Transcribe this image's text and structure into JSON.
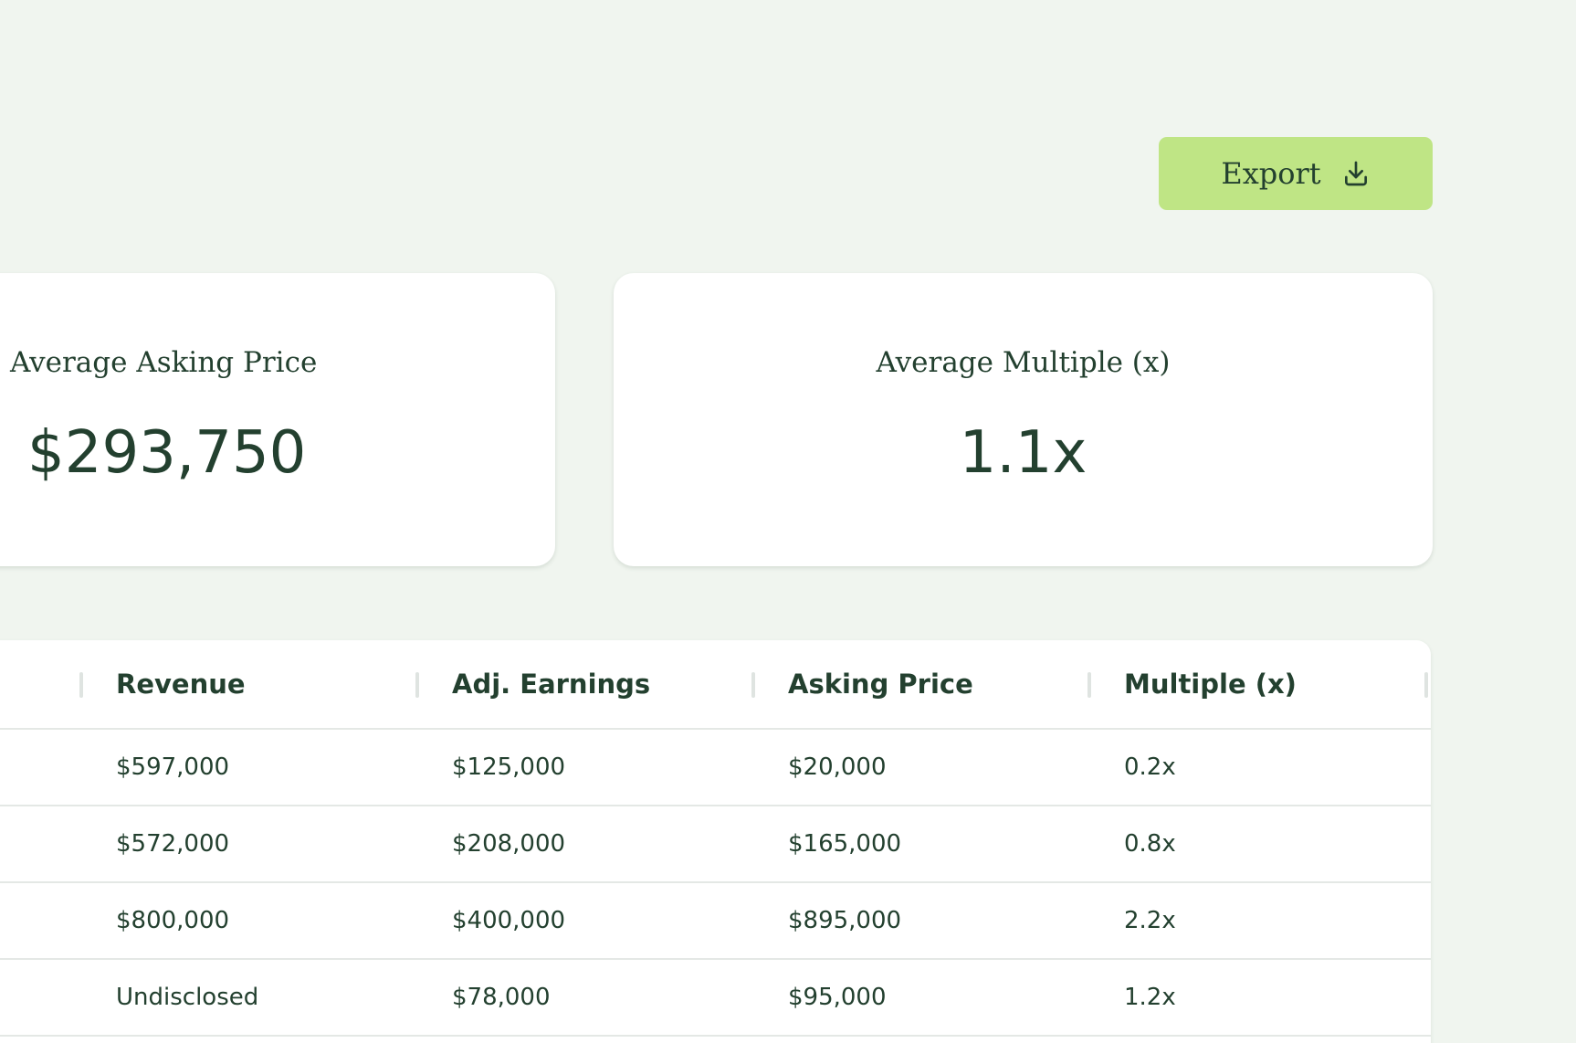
{
  "toolbar": {
    "export_label": "Export",
    "export_icon": "download-icon"
  },
  "stats": [
    {
      "label": "Average Asking Price",
      "value": "$293,750"
    },
    {
      "label": "Average Multiple (x)",
      "value": "1.1x"
    }
  ],
  "table": {
    "columns": [
      "Revenue",
      "Adj. Earnings",
      "Asking Price",
      "Multiple (x)"
    ],
    "rows": [
      [
        "$597,000",
        "$125,000",
        "$20,000",
        "0.2x"
      ],
      [
        "$572,000",
        "$208,000",
        "$165,000",
        "0.8x"
      ],
      [
        "$800,000",
        "$400,000",
        "$895,000",
        "2.2x"
      ],
      [
        "Undisclosed",
        "$78,000",
        "$95,000",
        "1.2x"
      ]
    ]
  },
  "colors": {
    "background": "#f0f5ef",
    "accent": "#bfe585",
    "text": "#23402f"
  }
}
